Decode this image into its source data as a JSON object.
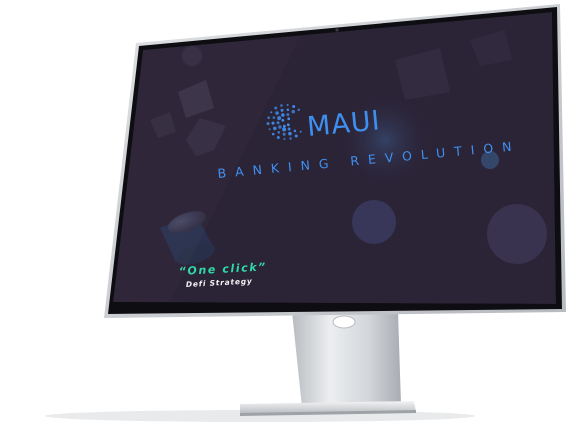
{
  "screen": {
    "brand_name": "MAUI",
    "tagline": "BANKING REVOLUTION",
    "quote": "“One click”",
    "subtitle": "Defi Strategy"
  },
  "icons": {
    "logo": "dotted-c-logo-icon",
    "camera": "camera-dot-icon"
  },
  "colors": {
    "screen_background": "#2b2336",
    "accent_blue": "#3f8ff0",
    "accent_green": "#2fd9a7",
    "bezel": "#0e0e12",
    "stand": "#d4d6da"
  }
}
